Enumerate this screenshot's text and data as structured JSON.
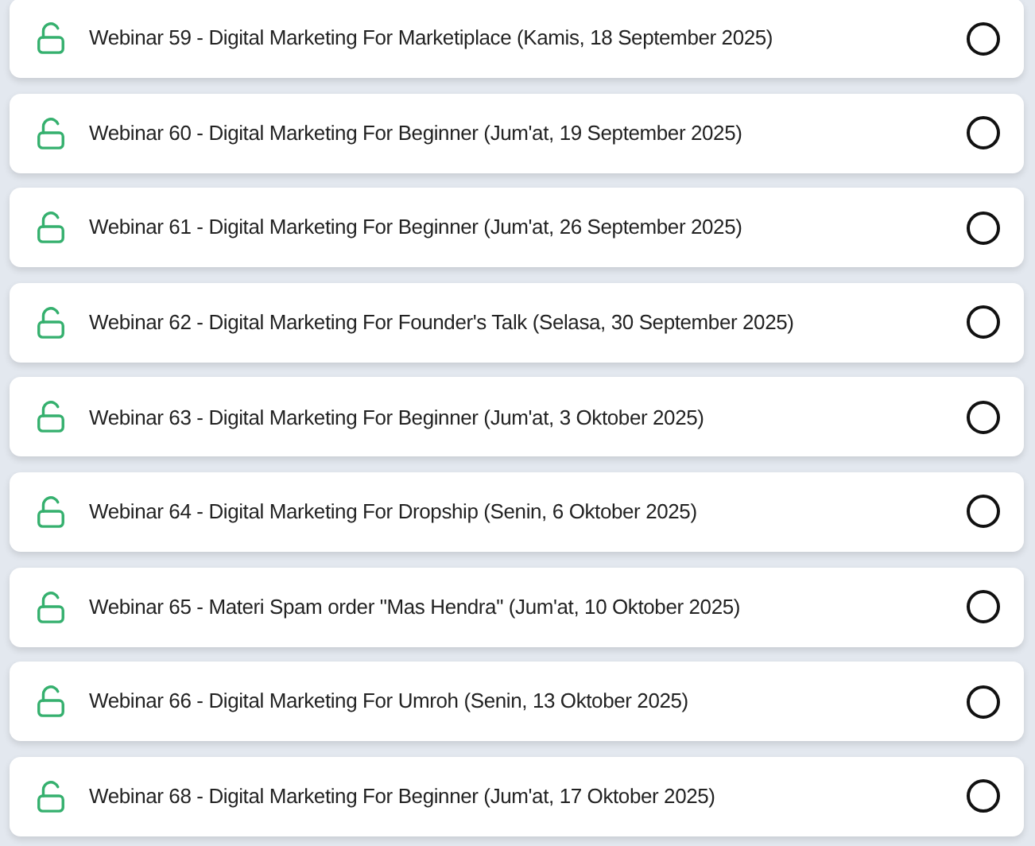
{
  "lessons": [
    {
      "title": "Webinar 59 - Digital Marketing For Marketiplace (Kamis, 18 September 2025)",
      "locked": false,
      "completed": false
    },
    {
      "title": "Webinar 60 - Digital Marketing For Beginner (Jum'at, 19 September 2025)",
      "locked": false,
      "completed": false
    },
    {
      "title": "Webinar 61 - Digital Marketing For Beginner (Jum'at, 26 September 2025)",
      "locked": false,
      "completed": false
    },
    {
      "title": "Webinar 62 - Digital Marketing For Founder's Talk (Selasa, 30 September 2025)",
      "locked": false,
      "completed": false
    },
    {
      "title": "Webinar 63 - Digital Marketing For Beginner (Jum'at, 3 Oktober 2025)",
      "locked": false,
      "completed": false
    },
    {
      "title": "Webinar 64 - Digital Marketing For Dropship (Senin, 6 Oktober 2025)",
      "locked": false,
      "completed": false
    },
    {
      "title": "Webinar 65 - Materi Spam order \"Mas Hendra\" (Jum'at, 10 Oktober 2025)",
      "locked": false,
      "completed": false
    },
    {
      "title": "Webinar 66 - Digital Marketing For Umroh (Senin, 13 Oktober 2025)",
      "locked": false,
      "completed": false
    },
    {
      "title": "Webinar 68 - Digital Marketing For Beginner (Jum'at, 17 Oktober 2025)",
      "locked": false,
      "completed": false
    }
  ]
}
